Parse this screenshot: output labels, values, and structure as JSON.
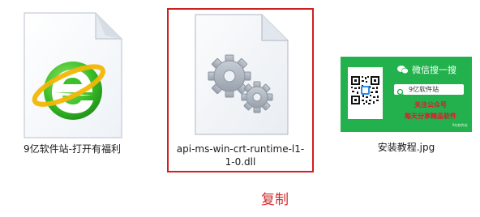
{
  "files": [
    {
      "name": "9亿软件站-打开有福利",
      "icon": "ie-style-shortcut-icon",
      "selected": false
    },
    {
      "name": "api-ms-win-crt-runtime-l1-1-0.dll",
      "icon": "dll-gears-file-icon",
      "selected": true
    },
    {
      "name": "安装教程.jpg",
      "icon": "wechat-qr-image-thumbnail",
      "selected": false
    }
  ],
  "thumbnail": {
    "title": "微信搜一搜",
    "search_text": "9亿软件站",
    "line1": "关注公众号",
    "line2": "每天分享精品软件",
    "footer": "9亿软件站"
  },
  "caption": "复制",
  "colors": {
    "selection_border": "#d21f1f",
    "caption": "#d32a2a",
    "wechat_green": "#22b14c",
    "promo_red": "#e8132b"
  }
}
